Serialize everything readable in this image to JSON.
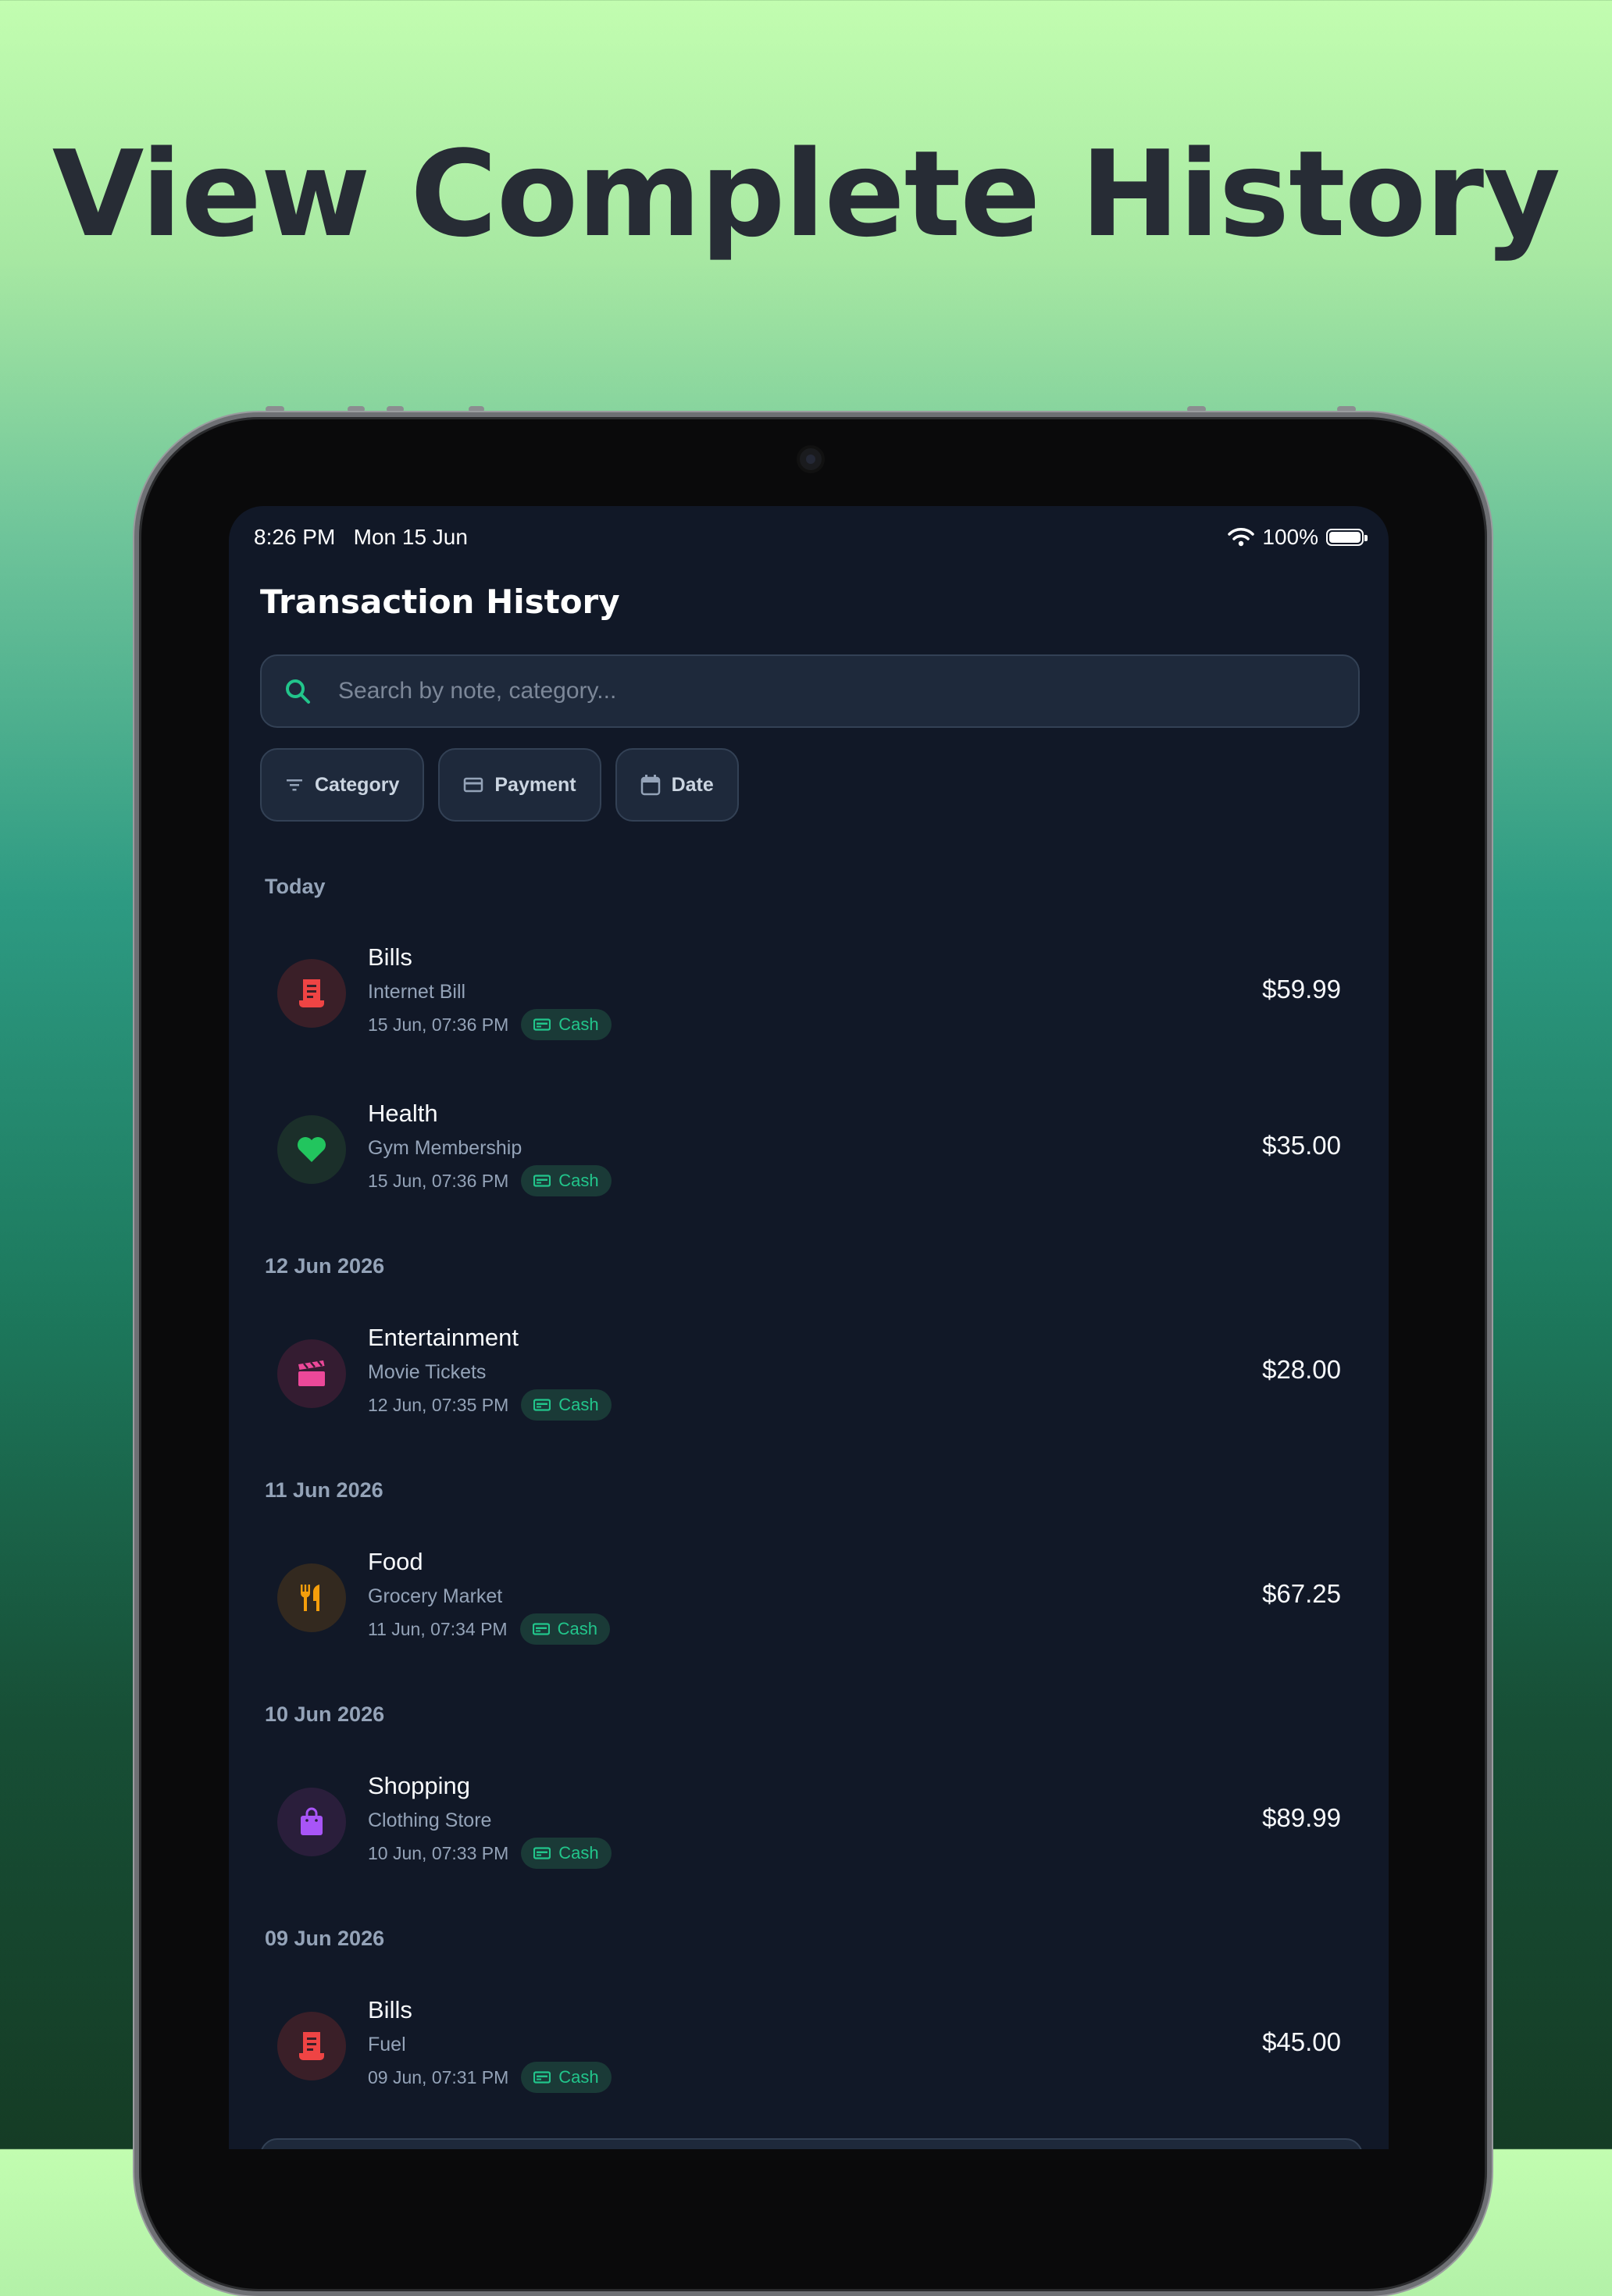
{
  "headline": "View Complete History",
  "status": {
    "time": "8:26 PM",
    "date": "Mon 15 Jun",
    "battery": "100%"
  },
  "screen_title": "Transaction History",
  "search": {
    "placeholder": "Search by note, category..."
  },
  "filters": [
    {
      "label": "Category",
      "icon": "filter-icon"
    },
    {
      "label": "Payment",
      "icon": "card-icon"
    },
    {
      "label": "Date",
      "icon": "calendar-icon"
    }
  ],
  "sections": [
    {
      "label": "Today",
      "transactions": [
        {
          "category": "Bills",
          "note": "Internet Bill",
          "datetime": "15 Jun, 07:36 PM",
          "payment": "Cash",
          "amount": "$59.99",
          "icon": "receipt-icon",
          "color": "#ef4444",
          "bg": "#3a1f28"
        },
        {
          "category": "Health",
          "note": "Gym Membership",
          "datetime": "15 Jun, 07:36 PM",
          "payment": "Cash",
          "amount": "$35.00",
          "icon": "heart-icon",
          "color": "#22c55e",
          "bg": "#1b2f2a"
        }
      ]
    },
    {
      "label": "12 Jun 2026",
      "transactions": [
        {
          "category": "Entertainment",
          "note": "Movie Tickets",
          "datetime": "12 Jun, 07:35 PM",
          "payment": "Cash",
          "amount": "$28.00",
          "icon": "clapperboard-icon",
          "color": "#ec4899",
          "bg": "#341c31"
        }
      ]
    },
    {
      "label": "11 Jun 2026",
      "transactions": [
        {
          "category": "Food",
          "note": "Grocery Market",
          "datetime": "11 Jun, 07:34 PM",
          "payment": "Cash",
          "amount": "$67.25",
          "icon": "utensils-icon",
          "color": "#f59e0b",
          "bg": "#33291f"
        }
      ]
    },
    {
      "label": "10 Jun 2026",
      "transactions": [
        {
          "category": "Shopping",
          "note": "Clothing Store",
          "datetime": "10 Jun, 07:33 PM",
          "payment": "Cash",
          "amount": "$89.99",
          "icon": "shopping-bag-icon",
          "color": "#a855f7",
          "bg": "#2a1e3b"
        }
      ]
    },
    {
      "label": "09 Jun 2026",
      "transactions": [
        {
          "category": "Bills",
          "note": "Fuel",
          "datetime": "09 Jun, 07:31 PM",
          "payment": "Cash",
          "amount": "$45.00",
          "icon": "receipt-icon",
          "color": "#ef4444",
          "bg": "#3a1f28"
        }
      ]
    }
  ]
}
